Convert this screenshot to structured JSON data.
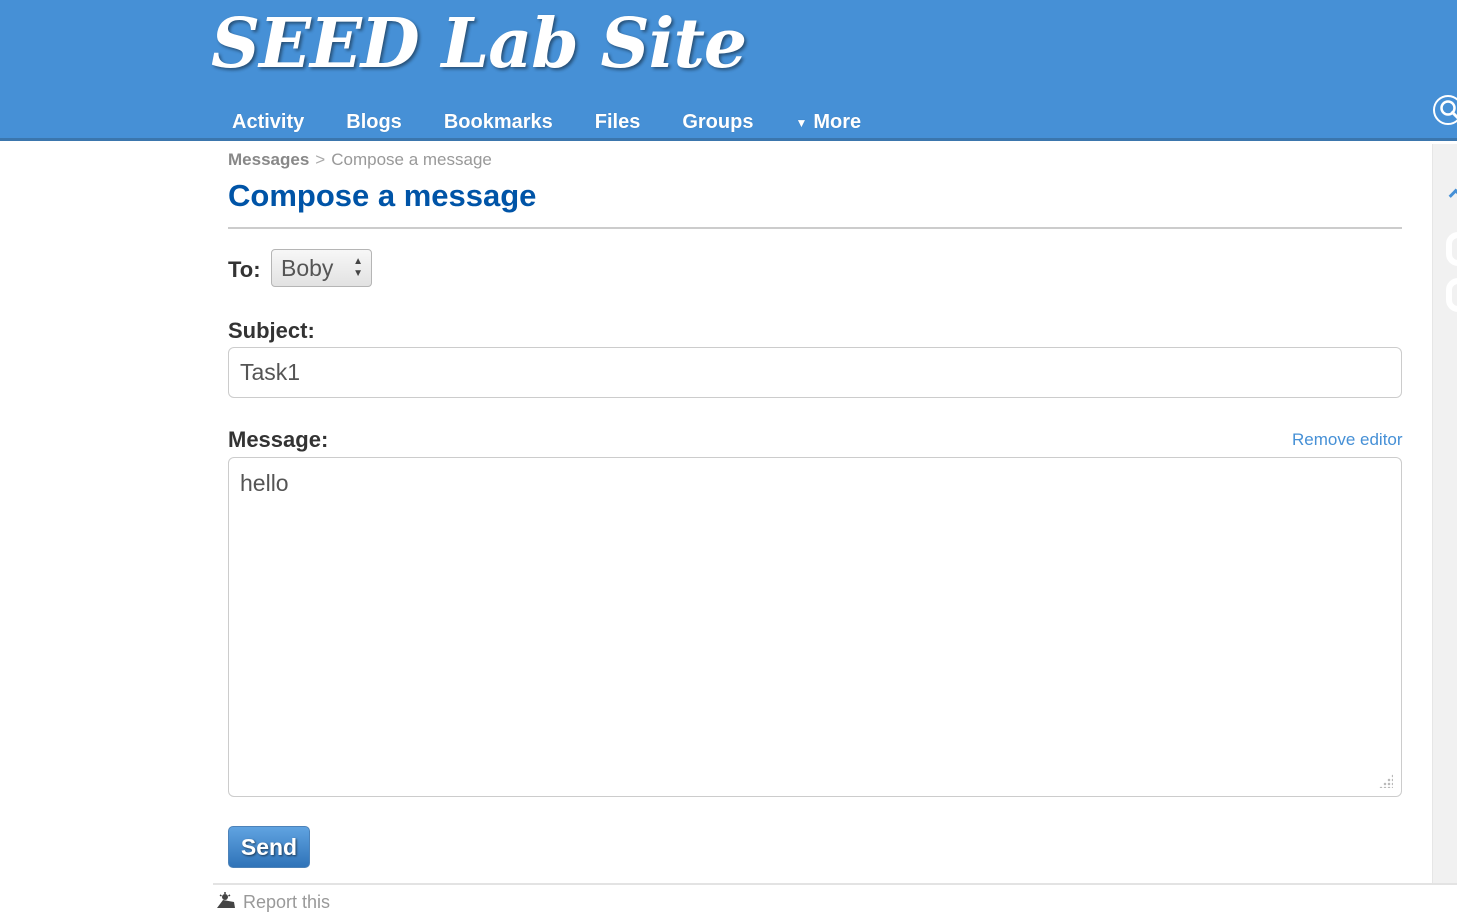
{
  "site": {
    "title": "SEED Lab Site"
  },
  "nav": {
    "items": [
      {
        "label": "Activity"
      },
      {
        "label": "Blogs"
      },
      {
        "label": "Bookmarks"
      },
      {
        "label": "Files"
      },
      {
        "label": "Groups"
      },
      {
        "label": "More",
        "caret": "▼"
      }
    ],
    "search_icon": "search-icon"
  },
  "breadcrumb": {
    "parent": "Messages",
    "separator": ">",
    "current": "Compose a message"
  },
  "page": {
    "title": "Compose a message"
  },
  "form": {
    "to_label": "To:",
    "to_value": "Boby",
    "subject_label": "Subject:",
    "subject_value": "Task1",
    "message_label": "Message:",
    "remove_editor": "Remove editor",
    "message_value": "hello",
    "send_label": "Send"
  },
  "footer": {
    "report_label": "Report this"
  },
  "colors": {
    "header_bg": "#4690d6",
    "title_blue": "#0054a7",
    "link_blue": "#4690d6"
  }
}
